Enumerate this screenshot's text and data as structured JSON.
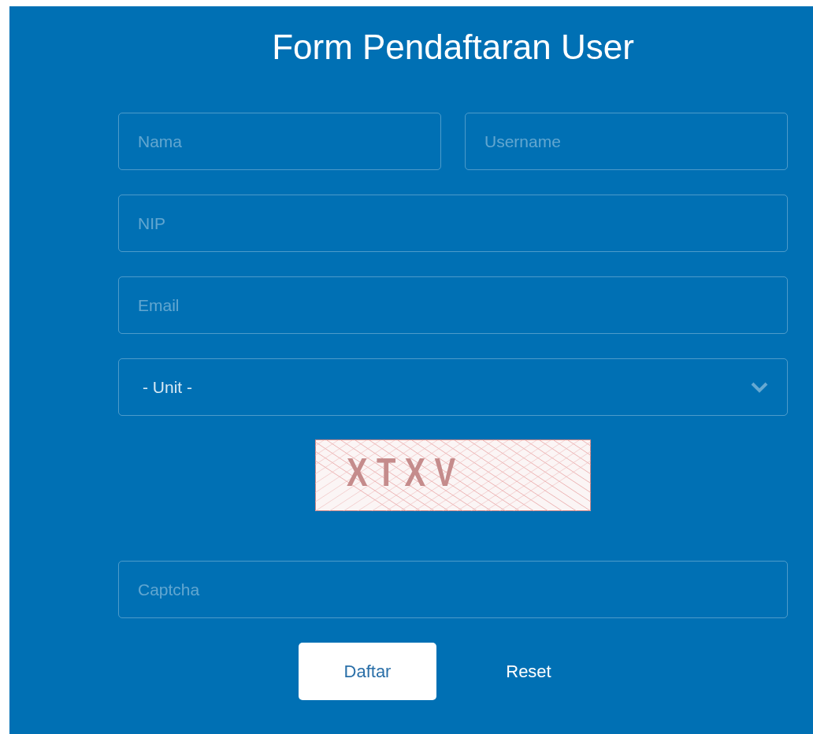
{
  "title": "Form Pendaftaran User",
  "fields": [
    {
      "placeholder": "Nama",
      "kind": "text"
    },
    {
      "placeholder": "Username",
      "kind": "text"
    },
    {
      "placeholder": "NIP",
      "kind": "text"
    },
    {
      "placeholder": "Email",
      "kind": "text"
    },
    {
      "value": "- Unit -",
      "kind": "select"
    }
  ],
  "captcha": {
    "text": "XTXV",
    "placeholder": "Captcha"
  },
  "buttons": [
    {
      "label": "Daftar",
      "kind": "primary"
    },
    {
      "label": "Reset",
      "kind": "plain"
    }
  ]
}
